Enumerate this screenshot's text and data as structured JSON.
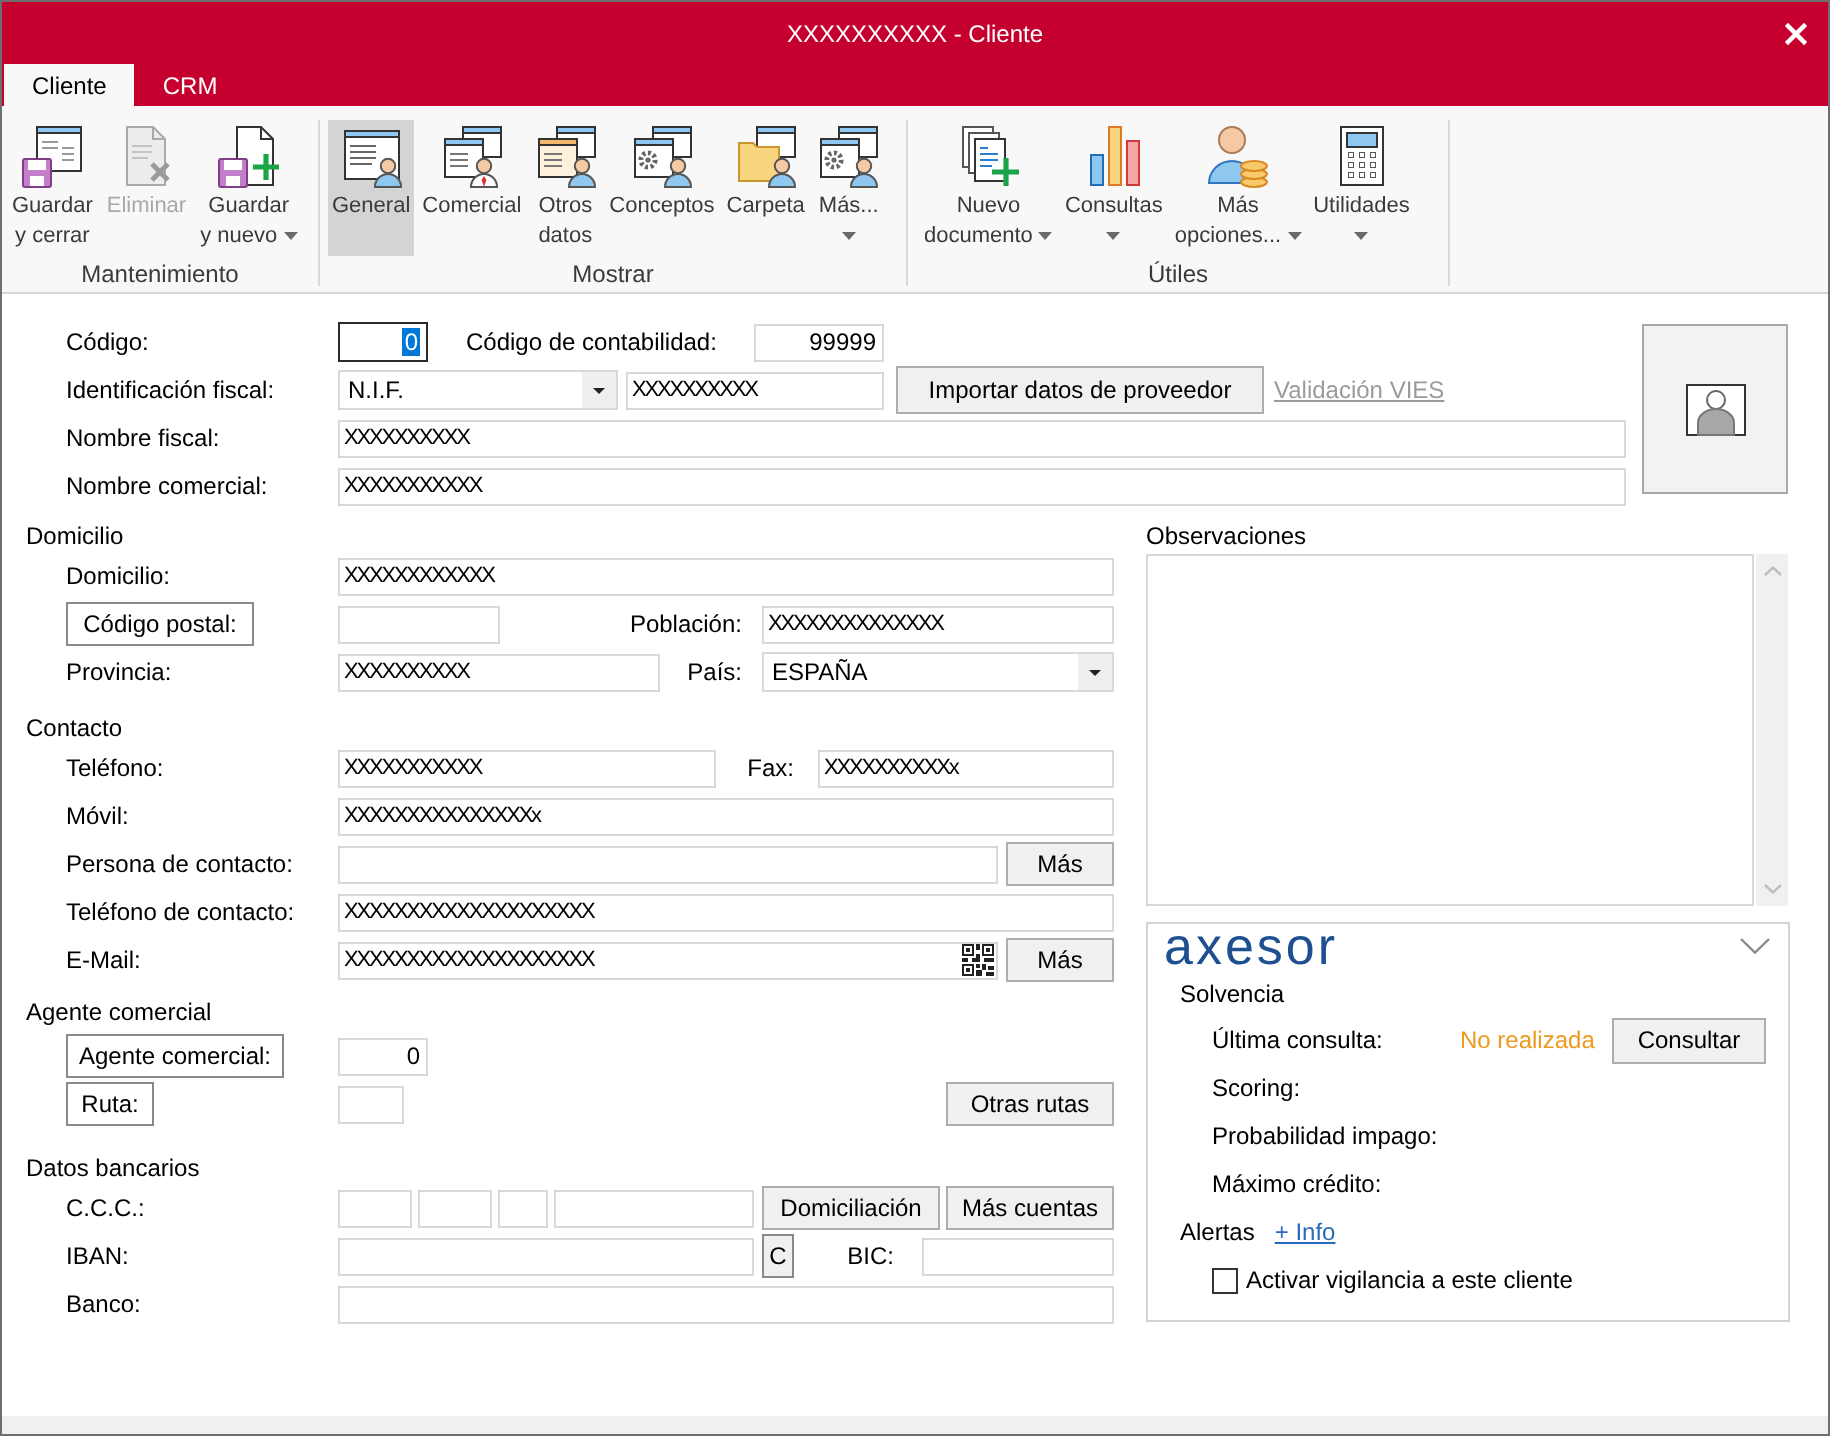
{
  "window": {
    "title": "XXXXXXXXXX - Cliente"
  },
  "tabs": [
    {
      "label": "Cliente",
      "selected": true
    },
    {
      "label": "CRM",
      "selected": false
    }
  ],
  "ribbon": {
    "groups": [
      {
        "label": "Mantenimiento",
        "buttons": [
          {
            "kind": "plain",
            "label": "Guardar\ny cerrar",
            "disabled": false
          },
          {
            "kind": "plain",
            "label": "Eliminar",
            "disabled": true
          },
          {
            "kind": "split",
            "label": "Guardar\ny nuevo",
            "disabled": false
          }
        ]
      },
      {
        "label": "Mostrar",
        "buttons": [
          {
            "kind": "plain",
            "label": "General",
            "selected": true
          },
          {
            "kind": "plain",
            "label": "Comercial",
            "selected": false
          },
          {
            "kind": "plain",
            "label": "Otros\ndatos",
            "selected": false
          },
          {
            "kind": "plain",
            "label": "Conceptos",
            "selected": false
          },
          {
            "kind": "plain",
            "label": "Carpeta",
            "selected": false
          },
          {
            "kind": "dropdown",
            "label": "Más...",
            "selected": false
          }
        ]
      },
      {
        "label": "Útiles",
        "buttons": [
          {
            "kind": "split",
            "label": "Nuevo\ndocumento"
          },
          {
            "kind": "dropdown",
            "label": "Consultas"
          },
          {
            "kind": "split",
            "label": "Más\nopciones..."
          },
          {
            "kind": "dropdown",
            "label": "Utilidades"
          }
        ]
      }
    ]
  },
  "general": {
    "code": {
      "label": "Código:",
      "value": "0",
      "focused": true
    },
    "accounting_code": {
      "label": "Código de contabilidad:",
      "value": "99999"
    },
    "tax_id": {
      "label": "Identificación fiscal:",
      "id_type": "N.I.F.",
      "value": "XXXXXXXXXX"
    },
    "import_button": "Importar datos de proveedor",
    "vies_link": "Validación VIES",
    "fiscal_name": {
      "label": "Nombre fiscal:",
      "value": "XXXXXXXXXX"
    },
    "trade_name": {
      "label": "Nombre comercial:",
      "value": "XXXXXXXXXXX"
    }
  },
  "address": {
    "title": "Domicilio",
    "street": {
      "label": "Domicilio:",
      "value": "XXXXXXXXXXXX"
    },
    "postal_code": {
      "button": "Código postal:"
    },
    "town": {
      "label": "Población:",
      "value": "XXXXXXXXXXXXXX"
    },
    "province": {
      "label": "Provincia:",
      "value": "XXXXXXXXXX"
    },
    "country": {
      "label": "País:",
      "value": "ESPAÑA"
    }
  },
  "contact": {
    "title": "Contacto",
    "phone": {
      "label": "Teléfono:",
      "value": "XXXXXXXXXXX"
    },
    "fax": {
      "label": "Fax:",
      "value": "XXXXXXXXXXx"
    },
    "mobile": {
      "label": "Móvil:",
      "value": "XXXXXXXXXXXXXXXx"
    },
    "person": {
      "label": "Persona de contacto:",
      "button": "Más"
    },
    "contact_phone": {
      "label": "Teléfono de contacto:",
      "value": "XXXXXXXXXXXXXXXXXXXX"
    },
    "email": {
      "label": "E-Mail:",
      "value": "XXXXXXXXXXXXXXXXXXXX",
      "button": "Más"
    }
  },
  "agent": {
    "title": "Agente comercial",
    "agent": {
      "button": "Agente comercial:",
      "value": "0"
    },
    "route": {
      "button": "Ruta:"
    },
    "other_routes_button": "Otras rutas"
  },
  "bank": {
    "title": "Datos bancarios",
    "ccc": {
      "label": "C.C.C.:"
    },
    "direct_debit_button": "Domiciliación",
    "more_accounts_button": "Más cuentas",
    "iban": {
      "label": "IBAN:",
      "button": "C"
    },
    "bic": {
      "label": "BIC:"
    },
    "bank_name": {
      "label": "Banco:"
    }
  },
  "notes": {
    "label": "Observaciones"
  },
  "axesor": {
    "logo": "axesor",
    "section": "Solvencia",
    "rows": [
      {
        "label": "Última consulta:",
        "value": "No realizada",
        "button": "Consultar"
      },
      {
        "label": "Scoring:"
      },
      {
        "label": "Probabilidad impago:"
      },
      {
        "label": "Máximo crédito:"
      }
    ],
    "alerts_label": "Alertas",
    "info_link": "+ Info",
    "watch": {
      "label": "Activar vigilancia a este cliente",
      "checked": false
    }
  }
}
